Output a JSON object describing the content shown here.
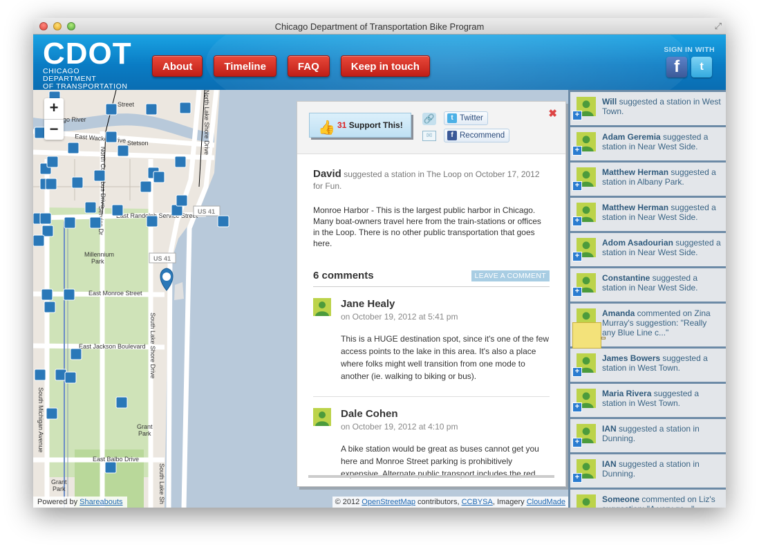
{
  "window": {
    "title": "Chicago Department of Transportation Bike Program"
  },
  "header": {
    "logo_main": "CDOT",
    "logo_line1": "Chicago Department",
    "logo_line2": "of Transportation",
    "nav": [
      "About",
      "Timeline",
      "FAQ",
      "Keep in touch"
    ],
    "signin_label": "SIGN IN WITH",
    "facebook_glyph": "f",
    "twitter_glyph": "t"
  },
  "map": {
    "street_labels": [
      "Street",
      "Chicago River",
      "East Wacker Drive",
      "North Columbus Drive",
      "Stetson",
      "Service Dr",
      "North Service Dr",
      "East Randolph Service Street",
      "US 41",
      "US 41",
      "Millennium Park",
      "East Monroe Street",
      "East Jackson Boulevard",
      "East Balbo Drive",
      "South Lake Shore Drive",
      "South Lake Shore Drive",
      "North Lake Shore Drive",
      "South Michigan Avenue",
      "Grant Park",
      "Grant Park",
      "South Lake Sh"
    ],
    "zoom_in": "+",
    "zoom_out": "−",
    "powered_prefix": "Powered by ",
    "powered_link": "Shareabouts",
    "attribution": {
      "copyright": "© 2012 ",
      "osm": "OpenStreetMap",
      "contributors": " contributors, ",
      "license": "CCBYSA",
      "imagery": ", Imagery ",
      "cloudmade": "CloudMade"
    },
    "accent_color": "#2a78b8"
  },
  "place": {
    "support_count": "31",
    "support_label": "Support This!",
    "twitter_label": "Twitter",
    "recommend_label": "Recommend",
    "close": "✖",
    "author": "David",
    "meta": "suggested a station in The Loop on October 17, 2012 for Fun.",
    "description": "Monroe Harbor - This is the largest public harbor in Chicago. Many boat-owners travel here from the train-stations or offices in the Loop. There is no other public transportation that goes here.",
    "comments_count": "6 comments",
    "leave_comment": "LEAVE A COMMENT",
    "comments": [
      {
        "name": "Jane Healy",
        "date": "on October 19, 2012 at 5:41 pm",
        "text": "This is a HUGE destination spot, since it's one of the few access points to the lake in this area. It's also a place where folks might well transition from one mode to another (ie. walking to biking or bus)."
      },
      {
        "name": "Dale Cohen",
        "date": "on October 19, 2012 at 4:10 pm",
        "text": "A bike station would be great as buses cannot get you here and Monroe Street parking is prohibitively expensive. Alternate public transport includes the red"
      }
    ]
  },
  "activity": [
    {
      "name": "Will",
      "text": " suggested a station in West Town.",
      "type": "add"
    },
    {
      "name": "Adam Geremia",
      "text": " suggested a station in Near West Side.",
      "type": "add"
    },
    {
      "name": "Matthew Herman",
      "text": " suggested a station in Albany Park.",
      "type": "add"
    },
    {
      "name": "Matthew Herman",
      "text": " suggested a station in Near West Side.",
      "type": "add"
    },
    {
      "name": "Adom Asadourian",
      "text": " suggested a station in Near West Side.",
      "type": "add"
    },
    {
      "name": "Constantine",
      "text": " suggested a station in Near West Side.",
      "type": "add"
    },
    {
      "name": "Amanda",
      "text": " commented on Zina Murray's suggestion: \"Really any Blue Line c...\"",
      "type": "comment"
    },
    {
      "name": "James Bowers",
      "text": " suggested a station in West Town.",
      "type": "add"
    },
    {
      "name": "Maria Rivera",
      "text": " suggested a station in West Town.",
      "type": "add"
    },
    {
      "name": "IAN",
      "text": " suggested a station in Dunning.",
      "type": "add"
    },
    {
      "name": "IAN",
      "text": " suggested a station in Dunning.",
      "type": "add"
    },
    {
      "name": "Someone",
      "text": " commented on Liz's suggestion: \"A very go...\"",
      "type": "comment"
    }
  ]
}
